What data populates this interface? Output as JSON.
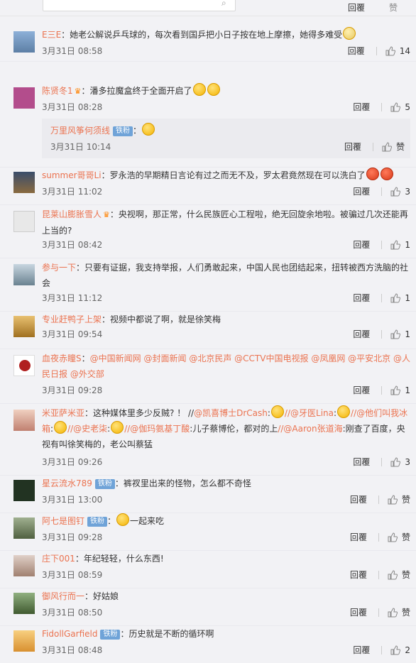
{
  "top": {
    "reply_label": "回覆",
    "like_label": "赞"
  },
  "comments": [
    {
      "user": "E三E",
      "text": "：她老公解说乒乓球的，每次看到国乒把小日子按在地上摩擦，她得多难受",
      "date": "3月31日 08:58",
      "reply": "回覆",
      "likes": "14",
      "avatar_color": "#5d7fa5"
    },
    {
      "user": "陈贤冬1",
      "text": "：潘多拉魔盒终于全面开启了",
      "date": "3月31日 08:28",
      "reply": "回覆",
      "likes": "5",
      "avatar_color": "#b34d8c",
      "sub": {
        "user": "万里风筝何须线",
        "tag": "铁粉",
        "text": "：",
        "date": "3月31日 10:14",
        "reply": "回覆",
        "likes": "赞"
      }
    },
    {
      "user": "summer哥哥Li",
      "text": "：罗永浩的早期精日言论有过之而无不及，罗太君竟然现在可以洗白了",
      "date": "3月31日 11:02",
      "reply": "回覆",
      "likes": "3",
      "avatar_color": "#3a4d6b"
    },
    {
      "user": "昆莱山膨胀雪人",
      "text": "：央视啊，那正常，什么民族匠心工程啦，绝无回旋余地啦。被骗过几次还能再上当的?",
      "date": "3月31日 08:42",
      "reply": "回覆",
      "likes": "1",
      "avatar_color": "#e0e0e0"
    },
    {
      "user": "参与一下",
      "text": "：只要有证据，我支持举报，人们勇敢起来，中国人民也团结起来，扭转被西方洗脑的社会",
      "date": "3月31日 11:12",
      "reply": "回覆",
      "likes": "1",
      "avatar_color": "#8aa6b5"
    },
    {
      "user": "专业赶鸭子上架",
      "text": "：视频中都说了啊，就是徐笑梅",
      "date": "3月31日 09:54",
      "reply": "回覆",
      "likes": "1",
      "avatar_color": "#c99a3a"
    },
    {
      "user": "血夜赤瞳S",
      "text": "：",
      "mentions": [
        "@中国新闻网",
        "@封面新闻",
        "@北京民声",
        "@CCTV中国电视报",
        "@凤凰网",
        "@平安北京",
        "@人民日报",
        "@外交部"
      ],
      "date": "3月31日 09:28",
      "reply": "回覆",
      "likes": "1",
      "avatar_color": "#b02020"
    },
    {
      "user": "米亚萨米亚",
      "text_a": "：这种媒体里多少反贼? ！ //",
      "m1": "@凯喜博士DrCash",
      "t1": ":",
      "m2": "//@牙医Lina",
      "t2": ":",
      "m3": "//@他们叫我冰箱",
      "t3": ":",
      "m4": "//@史老柒",
      "t4": ":",
      "m5": "//@伽玛氨基丁酸",
      "t5": ":儿子蔡博伦，都对的上",
      "m6": "//@Aaron张道海",
      "t6": ":刚查了百度，央视有叫徐笑梅的，老公叫蔡猛",
      "date": "3月31日 09:26",
      "reply": "回覆",
      "likes": "3",
      "avatar_color": "#d8a080"
    },
    {
      "user": "星云流水789",
      "tag": "铁粉",
      "text": "：裤衩里出来的怪物，怎么都不奇怪",
      "date": "3月31日 13:00",
      "reply": "回覆",
      "likes": "赞",
      "avatar_color": "#223322"
    },
    {
      "user": "阿七是图钉",
      "tag": "铁粉",
      "text": "一起来吃",
      "date": "3月31日 09:28",
      "reply": "回覆",
      "likes": "赞",
      "avatar_color": "#7a9070"
    },
    {
      "user": "庄下001",
      "text": "：年纪轻轻，什么东西!",
      "date": "3月31日 08:59",
      "reply": "回覆",
      "likes": "赞",
      "avatar_color": "#c0a090"
    },
    {
      "user": "御风行而一",
      "text": "：好姑娘",
      "date": "3月31日 08:50",
      "reply": "回覆",
      "likes": "赞",
      "avatar_color": "#6a8a60"
    },
    {
      "user": "FidollGarfield",
      "tag": "铁粉",
      "text": "：历史就是不断的循环啊",
      "date": "3月31日 08:48",
      "reply": "回覆",
      "likes": "2",
      "avatar_color": "#e8a040"
    }
  ]
}
